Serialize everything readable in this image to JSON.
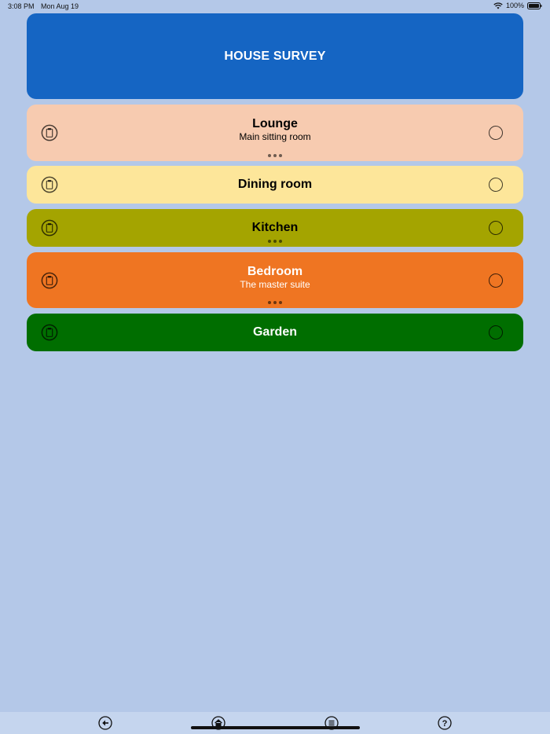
{
  "status_bar": {
    "time": "3:08 PM",
    "date": "Mon Aug 19",
    "battery": "100%",
    "icons": [
      "wifi-icon",
      "battery-icon"
    ]
  },
  "header": {
    "title": "HOUSE SURVEY",
    "color": "#1565c3"
  },
  "rooms": [
    {
      "name": "Lounge",
      "subtitle": "Main sitting room",
      "color": "#f7cbb0",
      "text_color": "#000000",
      "has_more": true,
      "icon": "clipboard-icon"
    },
    {
      "name": "Dining room",
      "subtitle": "",
      "color": "#fde69a",
      "text_color": "#000000",
      "has_more": false,
      "icon": "clipboard-icon"
    },
    {
      "name": "Kitchen",
      "subtitle": "",
      "color": "#a4a400",
      "text_color": "#000000",
      "has_more": true,
      "icon": "clipboard-icon"
    },
    {
      "name": "Bedroom",
      "subtitle": "The master suite",
      "color": "#ef7522",
      "text_color": "#ffffff",
      "has_more": true,
      "icon": "clipboard-icon"
    },
    {
      "name": "Garden",
      "subtitle": "",
      "color": "#006e00",
      "text_color": "#ffffff",
      "has_more": false,
      "icon": "clipboard-icon"
    }
  ],
  "toolbar": {
    "icons": [
      "back-arrow-icon",
      "home-icon",
      "menu-list-icon",
      "help-icon"
    ]
  }
}
